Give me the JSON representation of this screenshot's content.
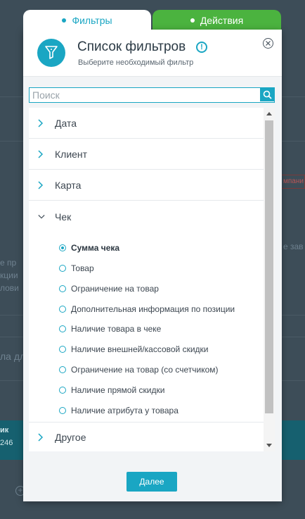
{
  "tabs": [
    {
      "label": "Фильтры",
      "active": true,
      "color": "#1aa6c3"
    },
    {
      "label": "Действия",
      "active": false,
      "color": "#4bb33f"
    }
  ],
  "dialog": {
    "title": "Список фильтров",
    "subtitle": "Выберите необходимый фильтр",
    "header_icon": "funnel-icon",
    "info_icon": "info-icon",
    "close_icon": "close-icon"
  },
  "search": {
    "placeholder": "Поиск",
    "value": "",
    "icon": "search-icon"
  },
  "categories": [
    {
      "label": "Дата",
      "expanded": false
    },
    {
      "label": "Клиент",
      "expanded": false
    },
    {
      "label": "Карта",
      "expanded": false
    },
    {
      "label": "Чек",
      "expanded": true,
      "options": [
        {
          "label": "Сумма чека",
          "selected": true
        },
        {
          "label": "Товар",
          "selected": false
        },
        {
          "label": "Ограничение на товар",
          "selected": false
        },
        {
          "label": "Дополнительная информация по позиции",
          "selected": false
        },
        {
          "label": "Наличие товара в чеке",
          "selected": false
        },
        {
          "label": "Наличие внешней/кассовой скидки",
          "selected": false
        },
        {
          "label": "Ограничение на товар (со счетчиком)",
          "selected": false
        },
        {
          "label": "Наличие прямой скидки",
          "selected": false
        },
        {
          "label": "Наличие атрибута у товара",
          "selected": false
        }
      ]
    },
    {
      "label": "Другое",
      "expanded": false
    }
  ],
  "footer": {
    "next_label": "Далее"
  },
  "background": {
    "fragments": [
      "е пр",
      "кции",
      "лови",
      "е зав",
      "мпани",
      "ла дл",
      "ик",
      "246"
    ]
  },
  "colors": {
    "accent": "#1aa6c3",
    "actions_tab": "#4bb33f",
    "overlay_bg": "#3d4d58"
  }
}
